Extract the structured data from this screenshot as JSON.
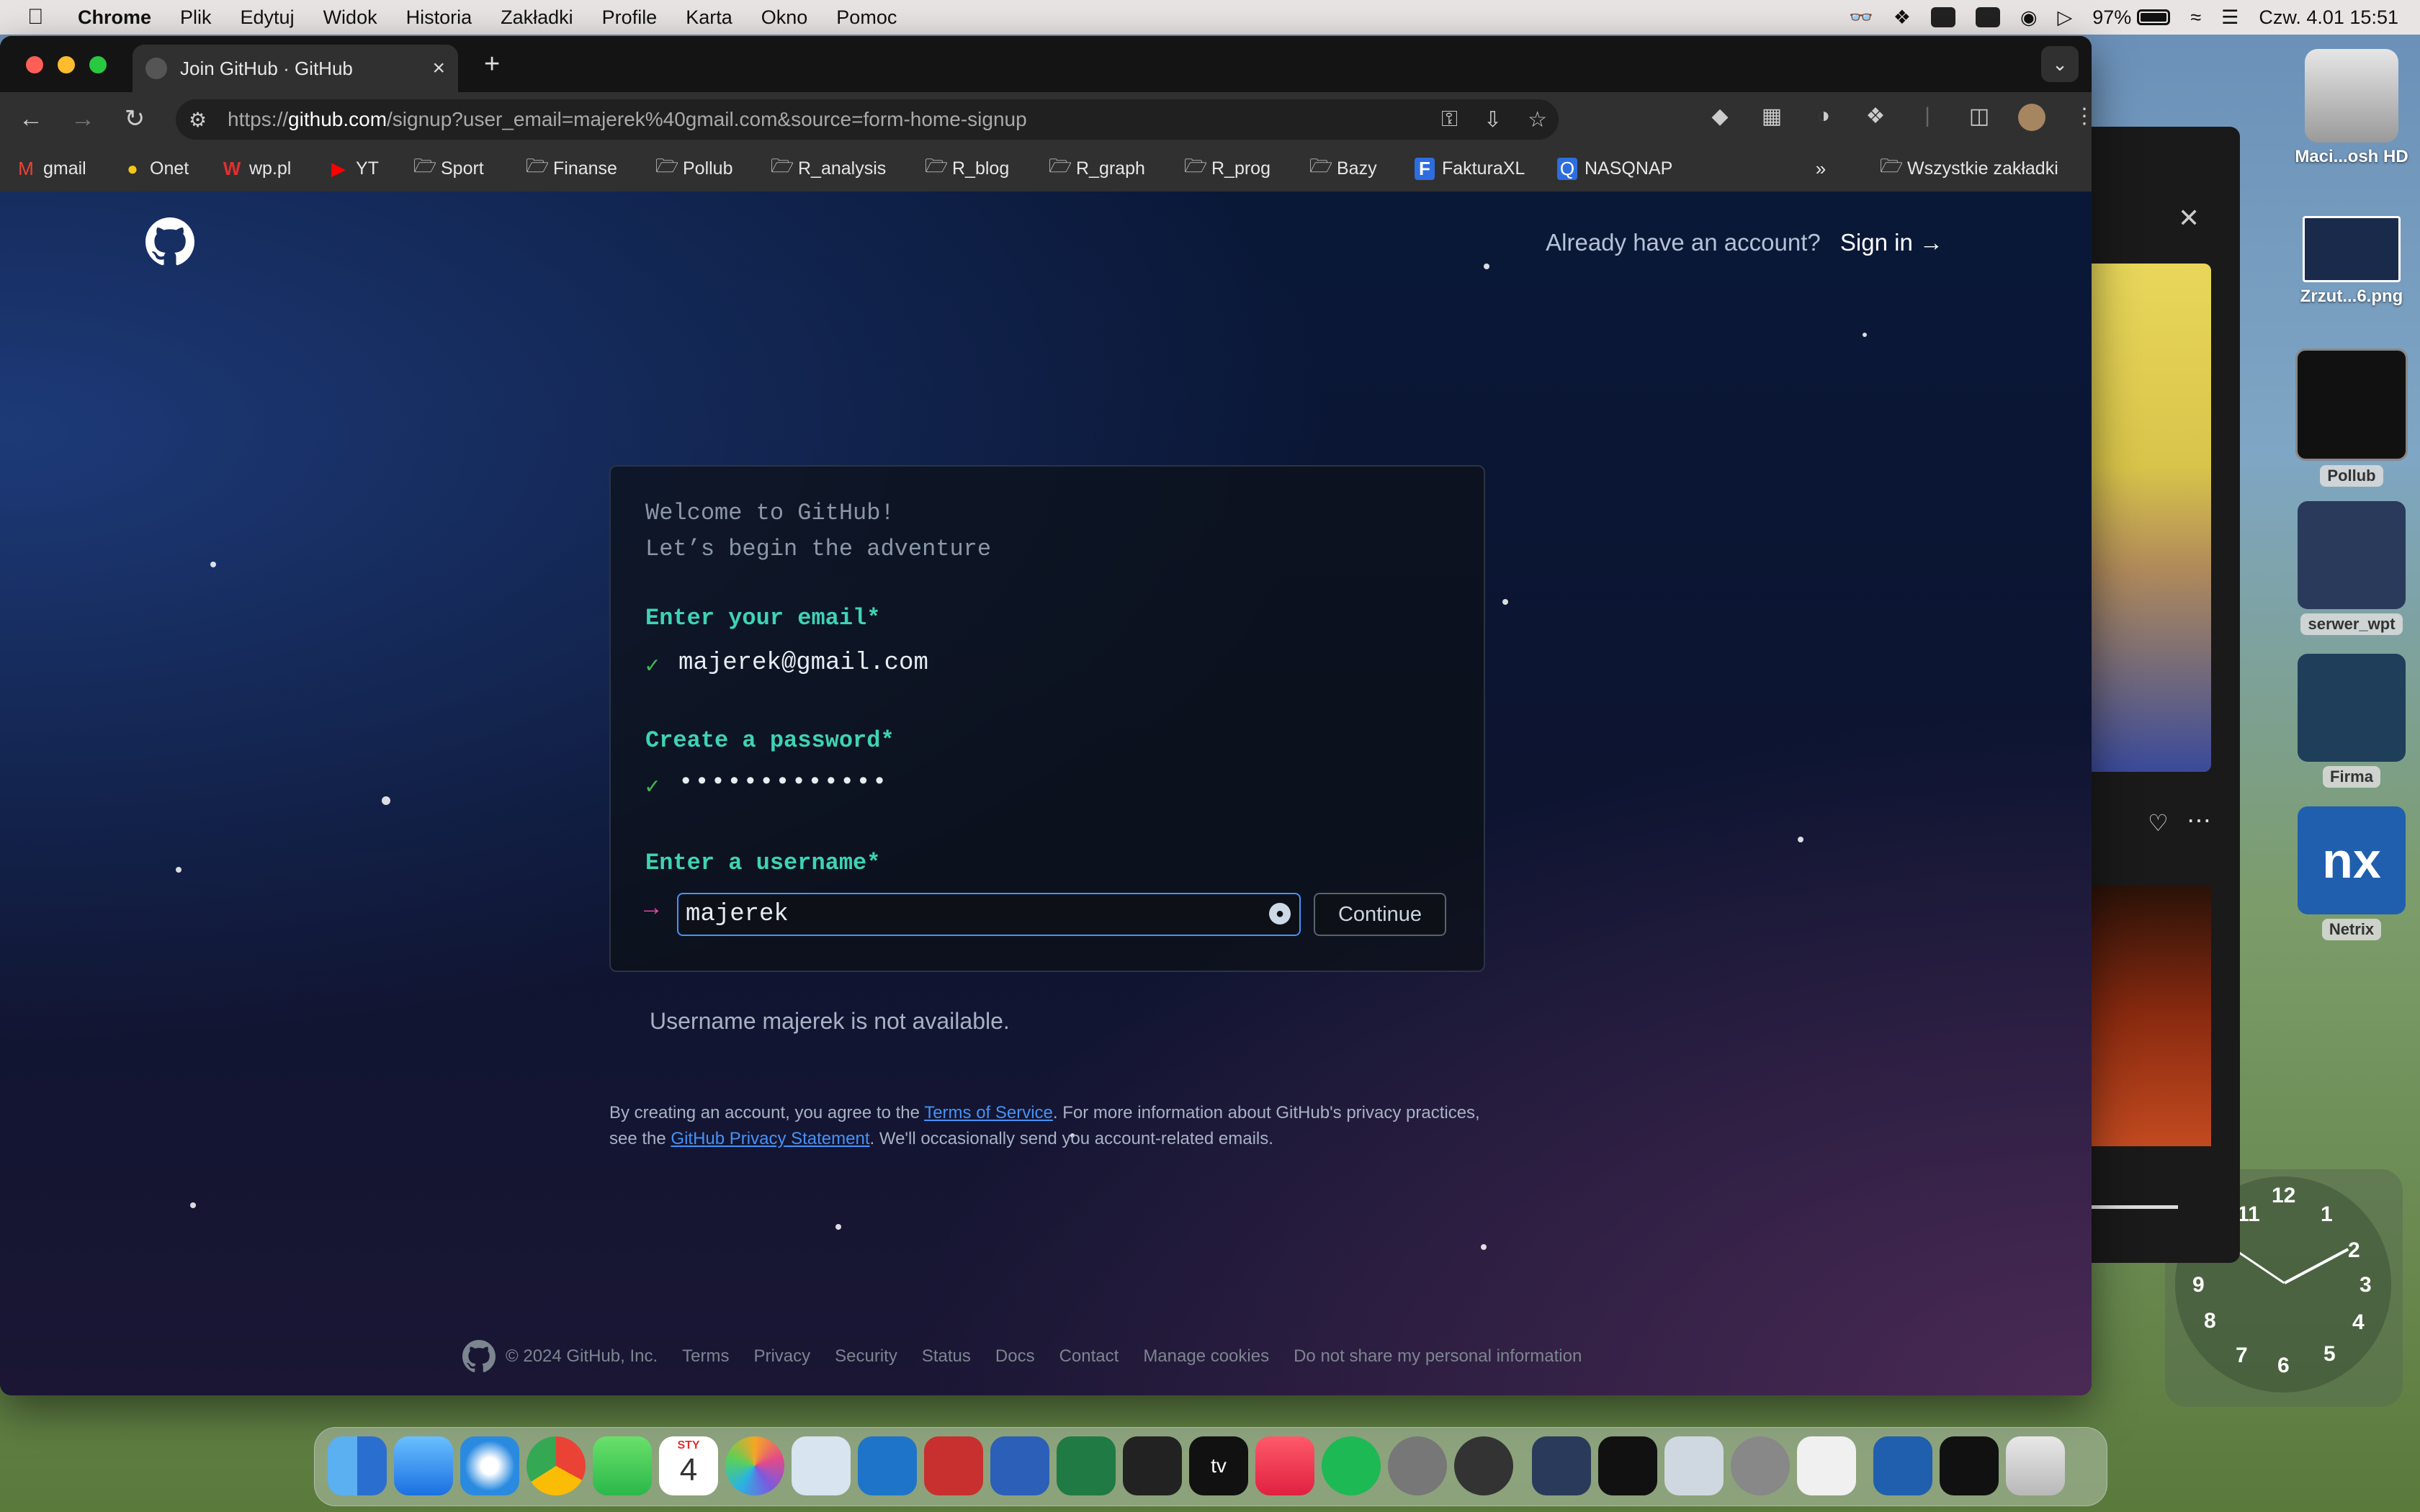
{
  "menubar": {
    "app_name": "Chrome",
    "menus": [
      "Plik",
      "Edytuj",
      "Widok",
      "Historia",
      "Zakładki",
      "Profile",
      "Karta",
      "Okno",
      "Pomoc"
    ],
    "battery": "97%",
    "datetime": "Czw. 4.01  15:51"
  },
  "browser": {
    "tab_title": "Join GitHub · GitHub",
    "url_scheme": "https://",
    "url_host": "github.com",
    "url_path": "/signup?user_email=majerek%40gmail.com&source=form-home-signup",
    "bookmarks": [
      {
        "label": "gmail",
        "icon": "gmail-icon"
      },
      {
        "label": "Onet",
        "icon": "onet-icon"
      },
      {
        "label": "wp.pl",
        "icon": "wp-icon"
      },
      {
        "label": "YT",
        "icon": "youtube-icon"
      },
      {
        "label": "Sport",
        "icon": "folder-icon"
      },
      {
        "label": "Finanse",
        "icon": "folder-icon"
      },
      {
        "label": "Pollub",
        "icon": "folder-icon"
      },
      {
        "label": "R_analysis",
        "icon": "folder-icon"
      },
      {
        "label": "R_blog",
        "icon": "folder-icon"
      },
      {
        "label": "R_graph",
        "icon": "folder-icon"
      },
      {
        "label": "R_prog",
        "icon": "folder-icon"
      },
      {
        "label": "Bazy",
        "icon": "folder-icon"
      },
      {
        "label": "FakturaXL",
        "icon": "fakturaxl-icon"
      },
      {
        "label": "NASQNAP",
        "icon": "nasqnap-icon"
      }
    ],
    "all_bookmarks": "Wszystkie zakładki"
  },
  "page": {
    "signin_prompt": "Already have an account?",
    "signin_link": "Sign in →",
    "welcome_line1": "Welcome to GitHub!",
    "welcome_line2": "Let’s begin the adventure",
    "email_label": "Enter your email*",
    "email_value": "majerek@gmail.com",
    "password_label": "Create a password*",
    "password_value": "•••••••••••••",
    "username_label": "Enter a username*",
    "username_value": "majerek",
    "continue_label": "Continue",
    "error": "Username majerek is not available.",
    "terms_pre": "By creating an account, you agree to the ",
    "terms_link": "Terms of Service",
    "terms_mid": ". For more information about GitHub's privacy practices, see the ",
    "privacy_link": "GitHub Privacy Statement",
    "terms_post": ". We'll occasionally send you account-related emails."
  },
  "footer": {
    "copyright": "© 2024 GitHub, Inc.",
    "links": [
      "Terms",
      "Privacy",
      "Security",
      "Status",
      "Docs",
      "Contact",
      "Manage cookies",
      "Do not share my personal information"
    ]
  },
  "desktop": {
    "items": [
      {
        "label": "Maci...osh HD",
        "icon": "hard-drive-icon"
      },
      {
        "label": "Zrzut...6.png",
        "icon": "screenshot-file-icon"
      },
      {
        "label": "Pollub",
        "icon": "parallels-icon"
      },
      {
        "label": "serwer_wpt",
        "icon": "server-icon"
      },
      {
        "label": "Firma",
        "icon": "buildings-chart-icon"
      },
      {
        "label": "Netrix",
        "icon": "nx-icon"
      }
    ]
  },
  "clock": {
    "numbers": [
      "12",
      "1",
      "2",
      "3",
      "4",
      "5",
      "6",
      "7",
      "8",
      "9",
      "11"
    ]
  },
  "dock": {
    "apps": [
      "finder",
      "mail",
      "safari",
      "chrome",
      "messages",
      "calendar",
      "photos",
      "rstudio",
      "vscode",
      "zotero",
      "word",
      "excel",
      "terminal",
      "apple-tv",
      "music",
      "spotify",
      "system-settings",
      "chatgpt",
      "devonthink",
      "activity-monitor",
      "preview",
      "tex",
      "textedit",
      "nx",
      "parallels",
      "trash"
    ],
    "calendar_month": "STY",
    "calendar_day": "4",
    "tv_label": "tv"
  }
}
